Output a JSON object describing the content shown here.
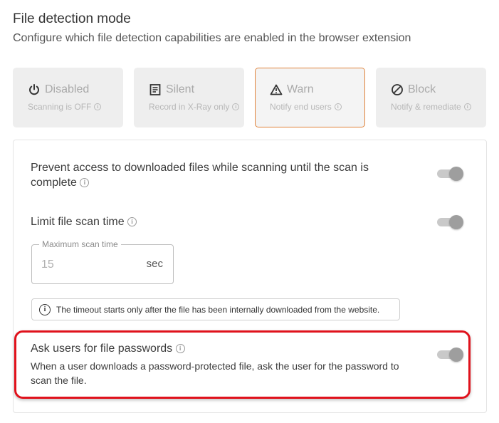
{
  "header": {
    "title": "File detection mode",
    "subtitle": "Configure which file detection capabilities are enabled in the browser extension"
  },
  "modes": [
    {
      "label": "Disabled",
      "description": "Scanning is OFF",
      "icon": "power-icon",
      "selected": false
    },
    {
      "label": "Silent",
      "description": "Record in X-Ray only",
      "icon": "document-icon",
      "selected": false
    },
    {
      "label": "Warn",
      "description": "Notify end users",
      "icon": "warning-icon",
      "selected": true
    },
    {
      "label": "Block",
      "description": "Notify & remediate",
      "icon": "block-icon",
      "selected": false
    }
  ],
  "settings": {
    "prevent_access": {
      "label_line1": "Prevent access to downloaded files while scanning until the scan is",
      "label_line2": "complete",
      "enabled": true
    },
    "limit_scan_time": {
      "label": "Limit file scan time",
      "enabled": true,
      "field_label": "Maximum scan time",
      "field_placeholder": "15",
      "field_unit": "sec",
      "note": "The timeout starts only after the file has been internally downloaded from the website."
    },
    "ask_passwords": {
      "label": "Ask users for file passwords",
      "description_line1": "When a user downloads a password-protected file, ask the user for the password to",
      "description_line2": "scan the file.",
      "enabled": true
    }
  },
  "colors": {
    "selected_border": "#e0833a",
    "highlight": "#e0121c",
    "toggle_track": "#c9c9c9",
    "toggle_knob": "#9e9e9e"
  }
}
